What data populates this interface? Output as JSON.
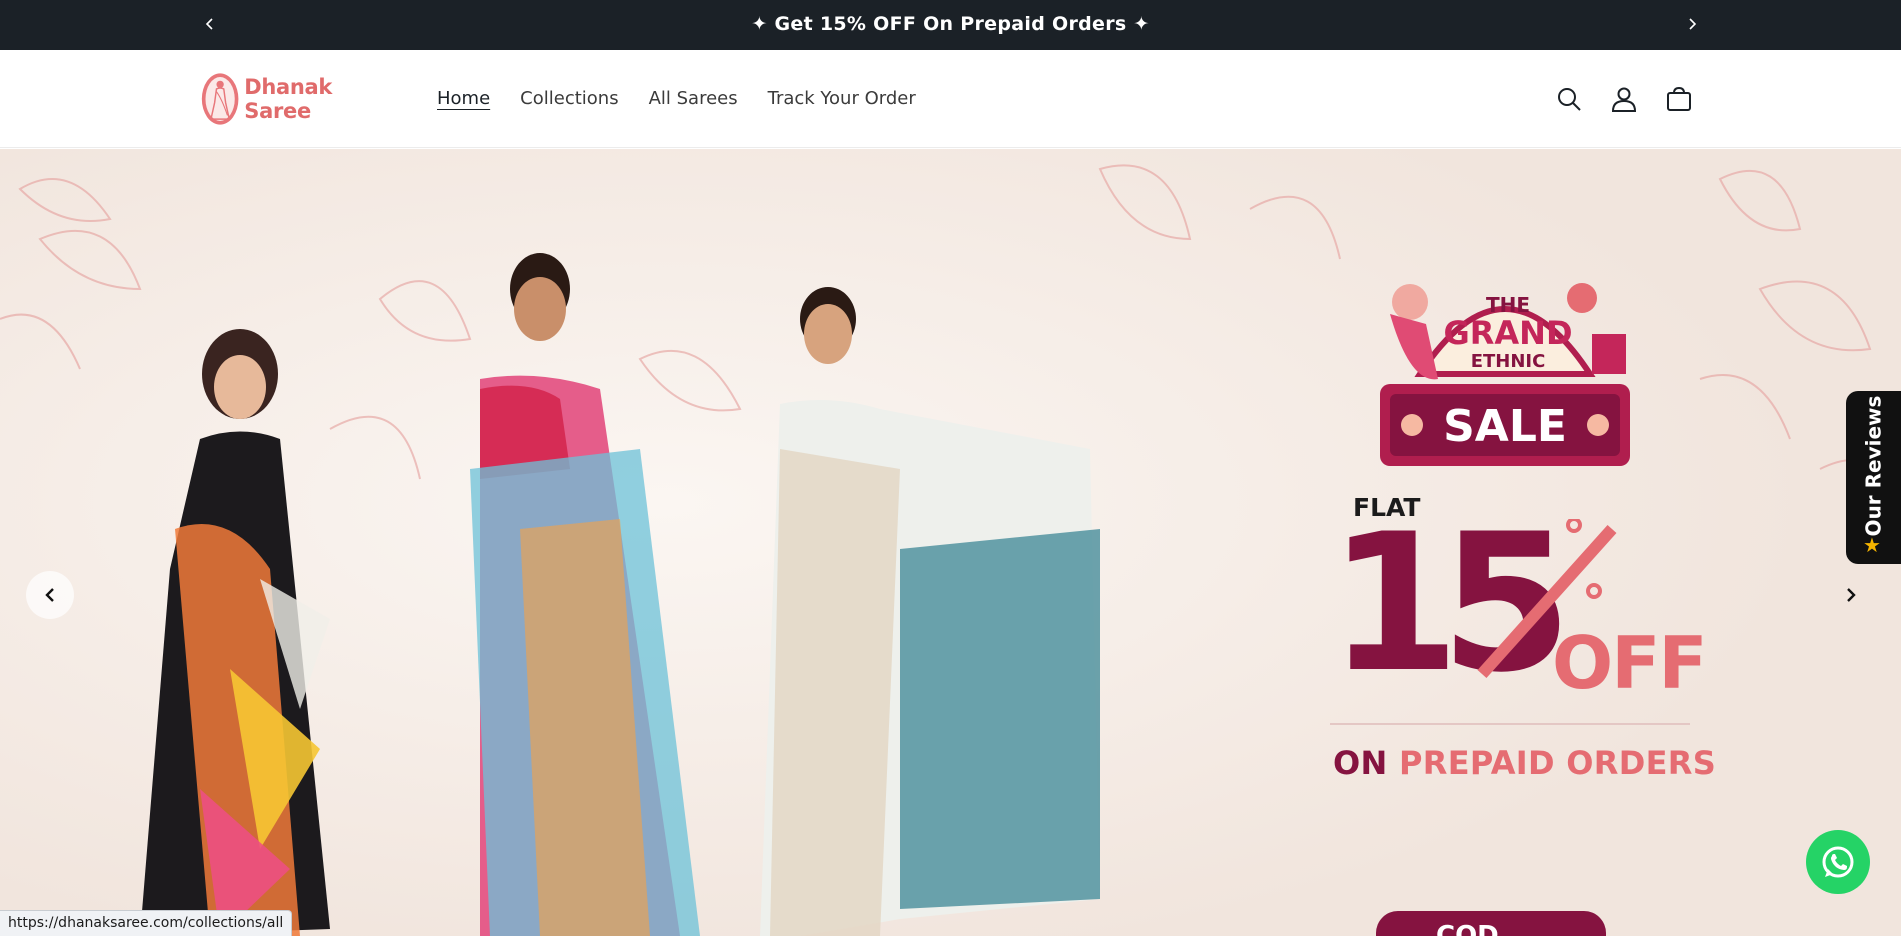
{
  "announcement": {
    "message": "✦ Get 15% OFF On Prepaid Orders ✦",
    "prev_icon": "chevron-left-icon",
    "next_icon": "chevron-right-icon"
  },
  "header": {
    "logo_text": "Dhanak Saree",
    "nav": [
      {
        "label": "Home",
        "active": true
      },
      {
        "label": "Collections",
        "active": false
      },
      {
        "label": "All Sarees",
        "active": false
      },
      {
        "label": "Track Your Order",
        "active": false
      }
    ],
    "icons": [
      "search-icon",
      "account-icon",
      "cart-icon"
    ]
  },
  "hero": {
    "badge": {
      "line1": "THE",
      "line2": "GRAND",
      "line3": "ETHNIC",
      "line4": "SALE"
    },
    "flat": "FLAT",
    "percent": "15",
    "off": "OFF",
    "on_prefix": "ON",
    "prepaid_text": "PREPAID ORDERS",
    "cod_text": "COD Available"
  },
  "widgets": {
    "reviews_label": "Our Reviews",
    "reviews_star": "★"
  },
  "status_bar": {
    "url": "https://dhanaksaree.com/collections/all"
  },
  "colors": {
    "announcement_bg": "#1b2127",
    "brand": "#e06b6b",
    "maroon": "#851340",
    "coral": "#e56c72",
    "whatsapp": "#25d366"
  }
}
